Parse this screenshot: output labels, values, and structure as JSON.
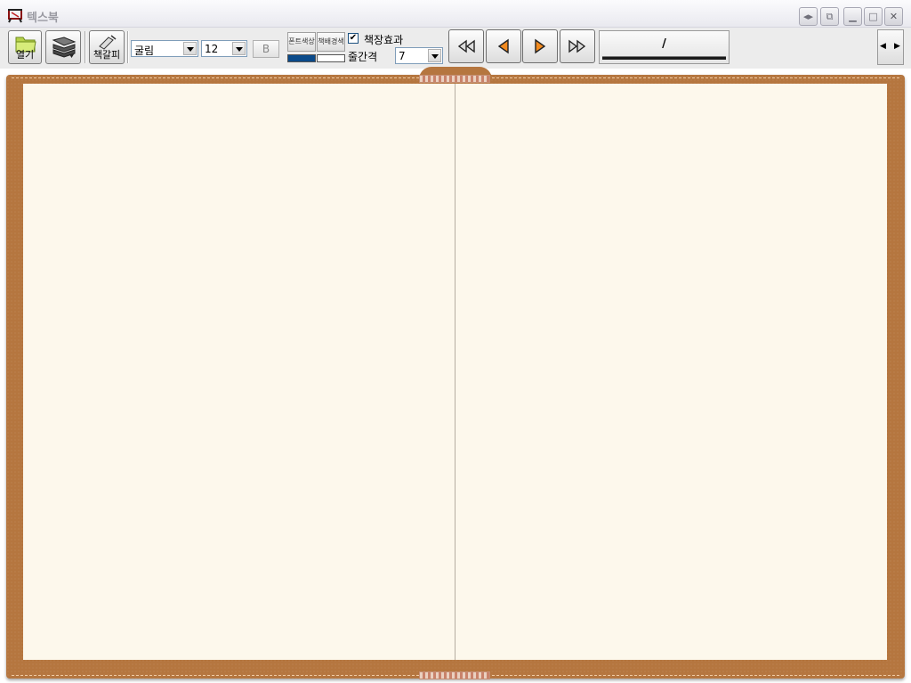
{
  "window": {
    "title": "텍스북",
    "icon": "app-logo-icon"
  },
  "toolbar": {
    "open_label": "열기",
    "bookmark_label": "책갈피",
    "font_name": "굴림",
    "font_size": "12",
    "bold_label": "B",
    "font_color_label": "폰트색상",
    "bg_color_label": "책배경색",
    "font_color": "#0a4a8a",
    "bg_color": "#ffffff",
    "book_effect_label": "책장효과",
    "book_effect_checked": true,
    "line_spacing_label": "줄간격",
    "line_spacing_value": "7",
    "page_indicator": "/"
  },
  "colors": {
    "cover": "#b5763f",
    "page": "#fdf8ec"
  }
}
